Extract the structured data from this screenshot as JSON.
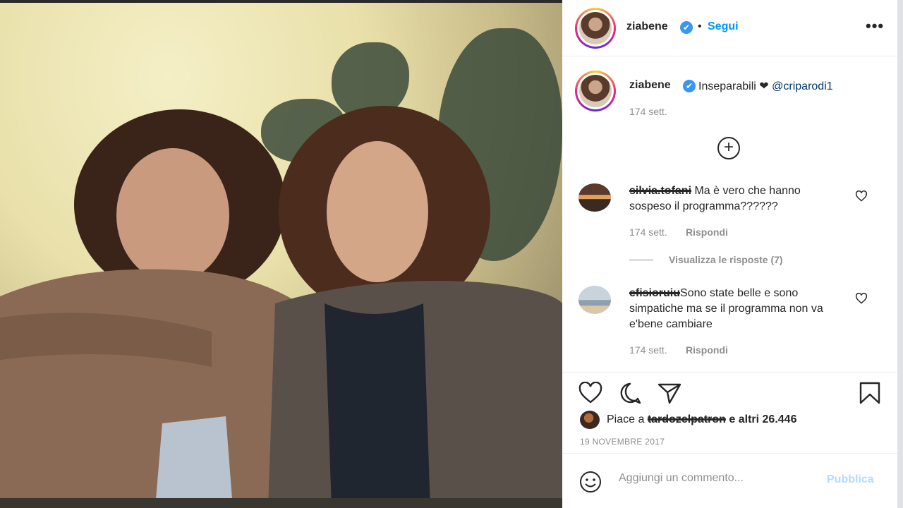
{
  "post": {
    "username": "ziabene",
    "verified_glyph": "✔",
    "separator": "•",
    "follow_label": "Segui",
    "more_glyph": "•••"
  },
  "caption": {
    "username": "ziabene",
    "text": "Inseparabili ❤",
    "mention": "@criparodi1",
    "time": "174 sett."
  },
  "load_more_glyph": "+",
  "comments": [
    {
      "username": "silvia.tofani",
      "text": " Ma è vero che hanno sospeso il programma??????",
      "time": "174 sett.",
      "reply_label": "Rispondi"
    },
    {
      "username": "efisioruiu",
      "text": "Sono state belle e sono simpatiche ma se il programma non va e'bene cambiare",
      "time": "174 sett.",
      "reply_label": "Rispondi"
    }
  ],
  "view_replies_label": "Visualizza le risposte (7)",
  "likes": {
    "prefix": "Piace a ",
    "liker": "tardozelpatron",
    "suffix": "e altri 26.446"
  },
  "date": "19 NOVEMBRE 2017",
  "add_comment": {
    "placeholder": "Aggiungi un commento...",
    "publish_label": "Pubblica"
  },
  "icons": [
    "heart-icon",
    "comment-icon",
    "share-icon",
    "bookmark-icon",
    "emoji-icon",
    "more-icon",
    "add-icon",
    "verified-icon"
  ],
  "colors": {
    "accent": "#0095f6",
    "verified": "#3897f0",
    "publish_disabled": "#b3dbff",
    "muted_text": "#8e8e8e"
  }
}
